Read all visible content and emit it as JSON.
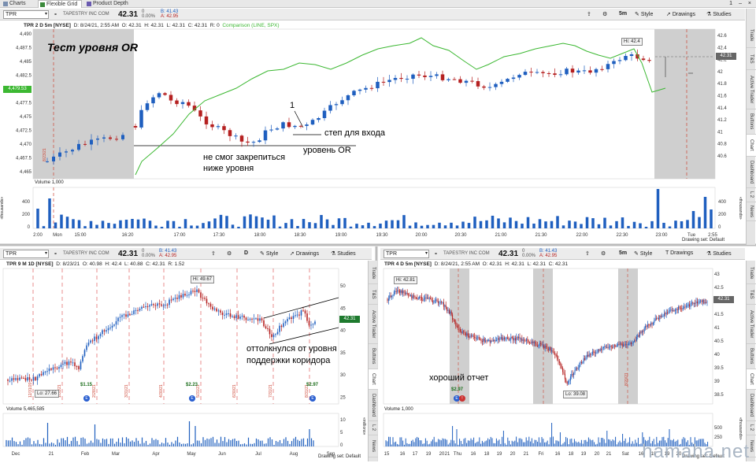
{
  "tabs": [
    "Charts",
    "Flexible Grid",
    "Product Depth"
  ],
  "top_right": {
    "badge": "1"
  },
  "pane_main": {
    "symbol": "TPR",
    "company": "TAPESTRY INC COM",
    "price": "42.31",
    "change_line1": "0",
    "change_line2": "0.00%",
    "bid": "B: 41.43",
    "ask": "A: 42.95",
    "timeframe": "5m",
    "style_label": "Style",
    "drawings_label": "Drawings",
    "studies_label": "Studies",
    "title": "TPR 2 D 5m [NYSE]",
    "date": "D: 8/24/21, 2:55 AM",
    "open": "O: 42.31",
    "high": "H: 42.31",
    "low": "L: 42.31",
    "close": "C: 42.31",
    "range": "R: 0",
    "comparison": "Comparison (LINE, SPX)",
    "left_axis": [
      "4,490",
      "4,487.5",
      "4,485",
      "4,482.5",
      "4,480",
      "4,477.5",
      "4,475",
      "4,472.5",
      "4,470",
      "4,467.5",
      "4,465"
    ],
    "left_marker": "4,479.53",
    "right_axis": [
      "42.6",
      "42.4",
      "42.2",
      "42",
      "41.8",
      "41.6",
      "41.4",
      "41.2",
      "41",
      "40.8",
      "40.6"
    ],
    "right_marker": "42.31",
    "hi_label": "Hi: 42.4",
    "volume_label": "Volume",
    "volume_value": "1,000",
    "vol_axis": [
      "400",
      "200",
      "0"
    ],
    "vol_unit": "«thousands»",
    "x_labels": [
      "2:00",
      "Mon",
      "15:00",
      "16:20",
      "17:00",
      "17:30",
      "18:00",
      "18:30",
      "19:00",
      "19:30",
      "20:00",
      "20:30",
      "21:00",
      "21:30",
      "22:00",
      "22:30",
      "23:00",
      "Tue",
      "2:55"
    ],
    "drawing_set": "Drawing set: Default",
    "notes": {
      "title": "Тест уровня OR",
      "fail": "не смог закрепиться\nниже уровня",
      "one": "1",
      "step": "степ для входа",
      "level": "уровень OR"
    }
  },
  "pane_bl": {
    "symbol": "TPR",
    "company": "TAPESTRY INC COM",
    "price": "42.31",
    "change_line1": "0",
    "change_line2": "0.00%",
    "bid": "B: 41.43",
    "ask": "A: 42.95",
    "timeframe": "D",
    "style_label": "Style",
    "drawings_label": "Drawings",
    "studies_label": "Studies",
    "title": "TPR 9 M 1D [NYSE]",
    "date": "D: 8/23/21",
    "open": "O: 40.98",
    "high": "H: 42.4",
    "low": "L: 40.88",
    "close": "C: 42.31",
    "range": "R: 1.52",
    "hi_label": "Hi: 49.67",
    "lo_label": "Lo: 27.66",
    "right_axis": [
      "50",
      "45",
      "40",
      "35",
      "30",
      "25"
    ],
    "right_marker": "42.31",
    "dividends": [
      "$1.15",
      "$2.23",
      "$2.97"
    ],
    "event_dates": [
      "12/31/20",
      "1/31/21",
      "2/28/21",
      "3/31/21",
      "4/30/21",
      "5/31/21",
      "6/30/21",
      "7/31/21",
      "8/31/21"
    ],
    "volume_label": "Volume",
    "volume_value": "5,465,585",
    "vol_axis": [
      "10",
      "5",
      "0"
    ],
    "vol_unit": "«millions»",
    "x_labels": [
      "Dec",
      "21",
      "Feb",
      "Mar",
      "Apr",
      "May",
      "Jun",
      "Jul",
      "Aug",
      "Sep"
    ],
    "drawing_set": "Drawing set: Default",
    "note": "оттолкнулся от уровня\nподдержки коридора"
  },
  "pane_br": {
    "symbol": "TPR",
    "company": "TAPESTRY INC COM",
    "price": "42.31",
    "change_line1": "0",
    "change_line2": "0.00%",
    "bid": "B: 41.43",
    "ask": "A: 42.95",
    "timeframe": "5m",
    "style_label": "Style",
    "drawings_label": "Drawings",
    "studies_label": "Studies",
    "title": "TPR 4 D 5m [NYSE]",
    "date": "D: 8/24/21, 2:55 AM",
    "open": "O: 42.31",
    "high": "H: 42.31",
    "low": "L: 42.31",
    "close": "C: 42.31",
    "hi_label": "Hi: 42.81",
    "lo_label": "Lo: 39.08",
    "dividend": "$2.97",
    "event_date": "8/20/21",
    "right_axis": [
      "43",
      "42.5",
      "42",
      "41.5",
      "41",
      "40.5",
      "40",
      "39.5",
      "39",
      "38.5"
    ],
    "right_marker": "42.31",
    "volume_label": "Volume",
    "volume_value": "1,000",
    "vol_axis": [
      "500",
      "250"
    ],
    "vol_unit": "«thousands»",
    "x_labels": [
      "15",
      "16",
      "17",
      "19",
      "20",
      "21",
      "Thu",
      "16",
      "18",
      "19",
      "20",
      "21",
      "Fri",
      "16",
      "18",
      "19",
      "20",
      "21",
      "Sat",
      "16",
      "18",
      "19",
      "20"
    ],
    "drawing_set": "Drawing set: Default",
    "note": "хороший отчет"
  },
  "sidebar_tabs": [
    "Trade",
    "T&S",
    "Active Trader",
    "Buttons",
    "Chart",
    "Dashboard",
    "L 2",
    "News"
  ],
  "colors": {
    "up": "#1f5fbf",
    "down": "#b52020",
    "comparison": "#3cb832",
    "volume": "#1f5fbf",
    "session_shade": "#c8c8c8"
  },
  "watermark": "hamaha.net"
}
